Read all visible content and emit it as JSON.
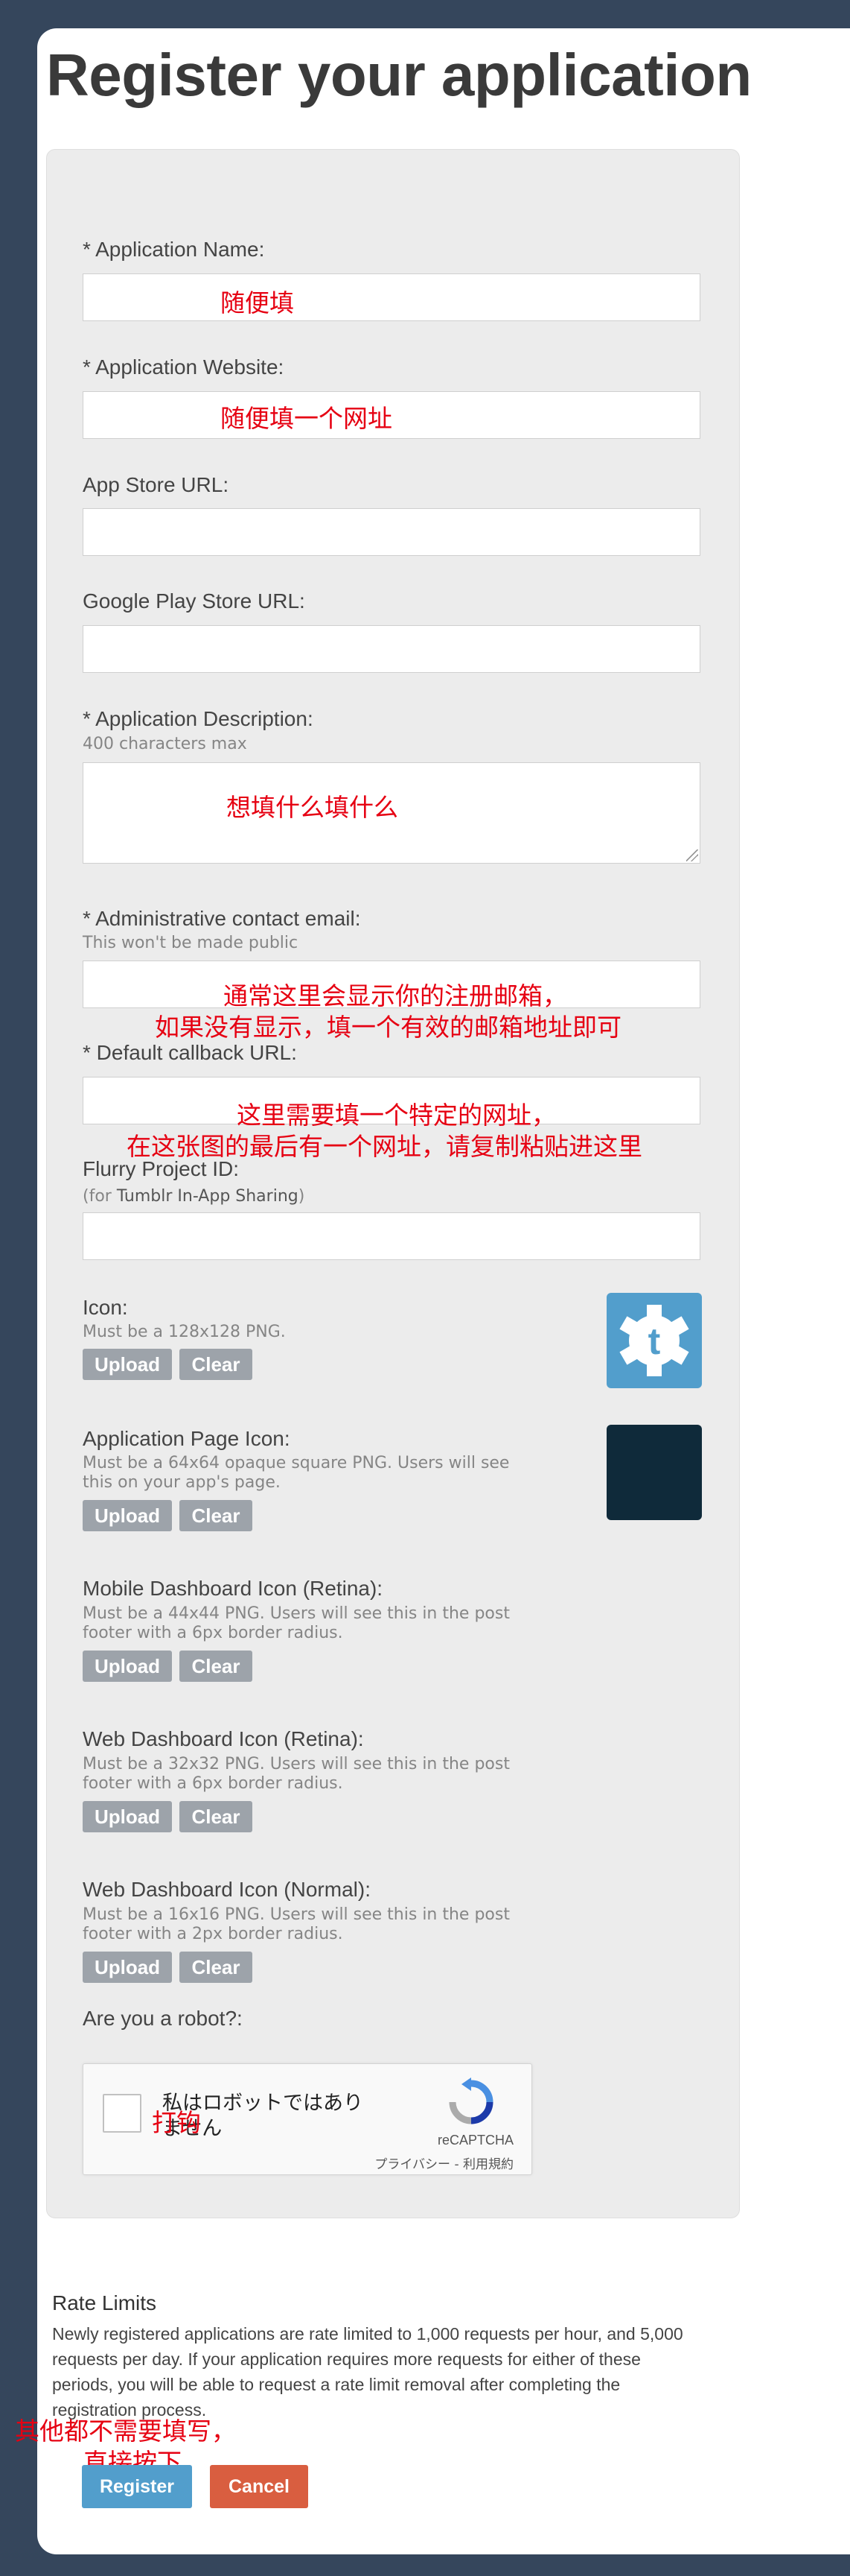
{
  "title": "Register your application",
  "fields": {
    "app_name": {
      "label": "* Application Name:",
      "value": ""
    },
    "app_website": {
      "label": "* Application Website:",
      "value": ""
    },
    "app_store_url": {
      "label": "App Store URL:",
      "value": ""
    },
    "google_play_url": {
      "label": "Google Play Store URL:",
      "value": ""
    },
    "description": {
      "label": "* Application Description:",
      "hint": "400 characters max",
      "value": ""
    },
    "admin_email": {
      "label": "* Administrative contact email:",
      "hint": "This won't be made public",
      "value": ""
    },
    "callback_url": {
      "label": "* Default callback URL:",
      "value": ""
    },
    "flurry": {
      "label": "Flurry Project ID:",
      "hint_prefix": "(for ",
      "hint_bold": "Tumblr In-App Sharing",
      "hint_suffix": ")",
      "value": ""
    }
  },
  "icons": [
    {
      "label": "Icon:",
      "hint": "Must be a 128x128 PNG."
    },
    {
      "label": "Application Page Icon:",
      "hint": "Must be a 64x64 opaque square PNG. Users will see this on your app's page."
    },
    {
      "label": "Mobile Dashboard Icon (Retina):",
      "hint": "Must be a 44x44 PNG. Users will see this in the post footer with a 6px border radius."
    },
    {
      "label": "Web Dashboard Icon (Retina):",
      "hint": "Must be a 32x32 PNG. Users will see this in the post footer with a 6px border radius."
    },
    {
      "label": "Web Dashboard Icon (Normal):",
      "hint": "Must be a 16x16 PNG. Users will see this in the post footer with a 2px border radius."
    }
  ],
  "upload_label": "Upload",
  "clear_label": "Clear",
  "captcha": {
    "question": "Are you a robot?:",
    "checkbox_text": "私はロボットではありません",
    "brand": "reCAPTCHA",
    "links": "プライバシー - 利用規約"
  },
  "rate_limits": {
    "title": "Rate Limits",
    "text": "Newly registered applications are rate limited to 1,000 requests per hour, and 5,000 requests per day. If your application requires more requests for either of these periods, you will be able to request a rate limit removal after completing the registration process."
  },
  "buttons": {
    "register": "Register",
    "cancel": "Cancel"
  },
  "annotations": {
    "name": "随便填",
    "website": "随便填一个网址",
    "description": "想填什么填什么",
    "email_1": "通常这里会显示你的注册邮箱，",
    "email_2": "如果没有显示，填一个有效的邮箱地址即可",
    "callback_1": "这里需要填一个特定的网址，",
    "callback_2": "在这张图的最后有一个网址，请复制粘贴进这里",
    "captcha": "打钩",
    "bottom_1": "其他都不需要填写，",
    "bottom_2": "直接按下"
  },
  "colors": {
    "background": "#35465c",
    "panel": "#ececec",
    "annotation": "#e60012",
    "register_button": "#529ecc",
    "cancel_button": "#d95e40",
    "tumblr_icon": "#529ecc",
    "app_page_icon": "#0f2a3a"
  }
}
